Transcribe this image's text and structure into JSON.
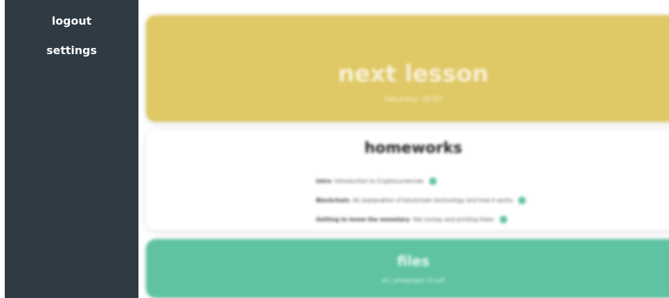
{
  "sidebar": {
    "items": [
      {
        "label": "logout"
      },
      {
        "label": "settings"
      }
    ]
  },
  "next_lesson": {
    "title": "next lesson",
    "subtitle": "Saturday 18:05"
  },
  "homeworks": {
    "title": "homeworks",
    "items": [
      {
        "name": "Intro",
        "description": "- Introduction to Cryptocurrencies"
      },
      {
        "name": "Blockchain",
        "description": "- An explanation of blockchain technology and how it works"
      },
      {
        "name": "Getting to know the monetary",
        "description": "- fiat money and printing them"
      }
    ]
  },
  "files": {
    "title": "files",
    "subtitle": "btc_whitepaper (1).pdf"
  },
  "colors": {
    "sidebar": "#2e3b44",
    "lesson_card": "#dfc865",
    "files_card": "#5fc3a1",
    "status_dot": "#5fc3a1"
  }
}
